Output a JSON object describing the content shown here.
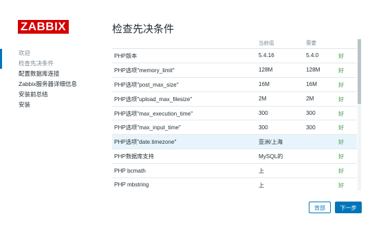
{
  "logo": "ZABBIX",
  "sidebar": {
    "items": [
      {
        "label": "欢迎",
        "state": "done"
      },
      {
        "label": "检查先决条件",
        "state": "current"
      },
      {
        "label": "配置数据库连接",
        "state": "todo"
      },
      {
        "label": "Zabbix服务器详细信息",
        "state": "todo"
      },
      {
        "label": "安装前总结",
        "state": "todo"
      },
      {
        "label": "安装",
        "state": "todo"
      }
    ]
  },
  "main": {
    "title": "检查先决条件",
    "columns": [
      "",
      "当前值",
      "需要",
      ""
    ],
    "rows": [
      {
        "name": "PHP版本",
        "current": "5.4.16",
        "required": "5.4.0",
        "status": "好"
      },
      {
        "name": "PHP选项\"memory_limit\"",
        "current": "128M",
        "required": "128M",
        "status": "好"
      },
      {
        "name": "PHP选项\"post_max_size\"",
        "current": "16M",
        "required": "16M",
        "status": "好"
      },
      {
        "name": "PHP选项\"upload_max_filesize\"",
        "current": "2M",
        "required": "2M",
        "status": "好"
      },
      {
        "name": "PHP选项\"max_execution_time\"",
        "current": "300",
        "required": "300",
        "status": "好"
      },
      {
        "name": "PHP选项\"max_input_time\"",
        "current": "300",
        "required": "300",
        "status": "好"
      },
      {
        "name": "PHP选项\"date.timezone\"",
        "current": "亚洲/上海",
        "required": "",
        "status": "好"
      },
      {
        "name": "PHP数据库支持",
        "current": "MySQL的",
        "required": "",
        "status": "好"
      },
      {
        "name": "PHP bcmath",
        "current": "上",
        "required": "",
        "status": "好"
      },
      {
        "name": "PHP mbstring",
        "current": "上",
        "required": "",
        "status": "好"
      }
    ]
  },
  "buttons": {
    "back": "背部",
    "next": "下一步"
  },
  "colors": {
    "brand": "#d40000",
    "accent": "#0275b8",
    "ok": "#429e47"
  }
}
